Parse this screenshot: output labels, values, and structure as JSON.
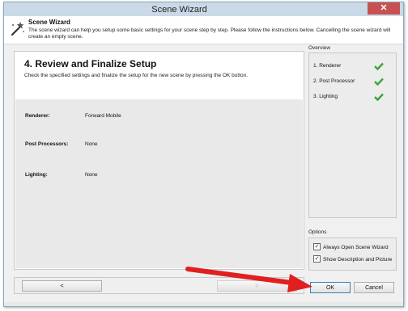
{
  "window": {
    "title": "Scene Wizard",
    "close_label": "✕"
  },
  "header": {
    "title": "Scene Wizard",
    "description": "The scene wizard can help you setup some basic settings for your scene step by step. Please follow the instructions below. Cancelling the scene wizard will create an empty scene."
  },
  "step": {
    "title": "4. Review and Finalize Setup",
    "description": "Check the specified settings and finalize the setup for the new scene by pressing the OK button."
  },
  "summary": {
    "rows": [
      {
        "label": "Renderer:",
        "value": "Forward Mobile"
      },
      {
        "label": "Post Processors:",
        "value": "None"
      },
      {
        "label": "Lighting:",
        "value": "None"
      }
    ]
  },
  "overview": {
    "label": "Overview",
    "items": [
      {
        "label": "1. Renderer",
        "status": "complete"
      },
      {
        "label": "2. Post Processor",
        "status": "complete"
      },
      {
        "label": "3. Lighting",
        "status": "complete"
      }
    ],
    "check_color": "#3aa53a"
  },
  "options": {
    "label": "Options",
    "items": [
      {
        "label": "Always Open Scene Wizard",
        "checked": true
      },
      {
        "label": "Show Description and Picture",
        "checked": true
      }
    ]
  },
  "nav": {
    "back_label": "<",
    "next_label": ">"
  },
  "buttons": {
    "ok_label": "OK",
    "cancel_label": "Cancel"
  },
  "annotation": {
    "arrow_color": "#e02020"
  }
}
